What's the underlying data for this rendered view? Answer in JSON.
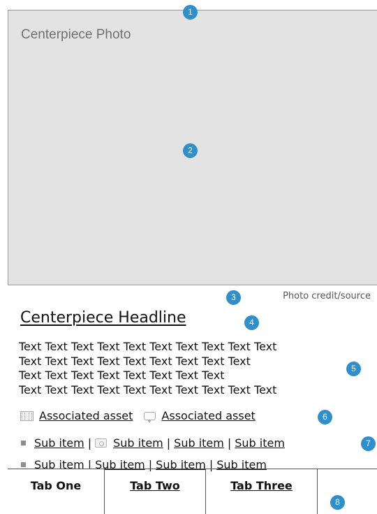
{
  "markers": [
    "1",
    "2",
    "3",
    "4",
    "5",
    "6",
    "7",
    "8"
  ],
  "photo": {
    "label": "Centerpiece Photo",
    "credit": "Photo credit/source"
  },
  "headline": "Centerpiece Headline",
  "body_lines": [
    "Text Text Text Text Text Text Text Text Text Text",
    "Text Text Text Text Text Text Text Text Text",
    "Text Text Text Text Text Text Text Text",
    "Text Text Text Text Text Text Text Text Text Text"
  ],
  "assets": [
    {
      "label": "Associated asset",
      "icon": "film-icon"
    },
    {
      "label": "Associated asset",
      "icon": "comment-icon"
    }
  ],
  "sub_rows": [
    {
      "items": [
        {
          "label": "Sub item"
        },
        {
          "label": "Sub item",
          "icon": "camera-icon"
        },
        {
          "label": "Sub item"
        },
        {
          "label": "Sub item"
        }
      ]
    },
    {
      "items": [
        {
          "label": "Sub item"
        },
        {
          "label": "Sub item"
        },
        {
          "label": "Sub item"
        },
        {
          "label": "Sub item"
        }
      ]
    }
  ],
  "separator": "|",
  "tabs": [
    {
      "label": "Tab One",
      "active": true
    },
    {
      "label": "Tab Two",
      "active": false
    },
    {
      "label": "Tab Three",
      "active": false
    }
  ],
  "colors": {
    "marker": "#2f8fcb",
    "photo_bg": "#e3e3e3",
    "text": "#111111",
    "muted": "#6f6f6f"
  }
}
